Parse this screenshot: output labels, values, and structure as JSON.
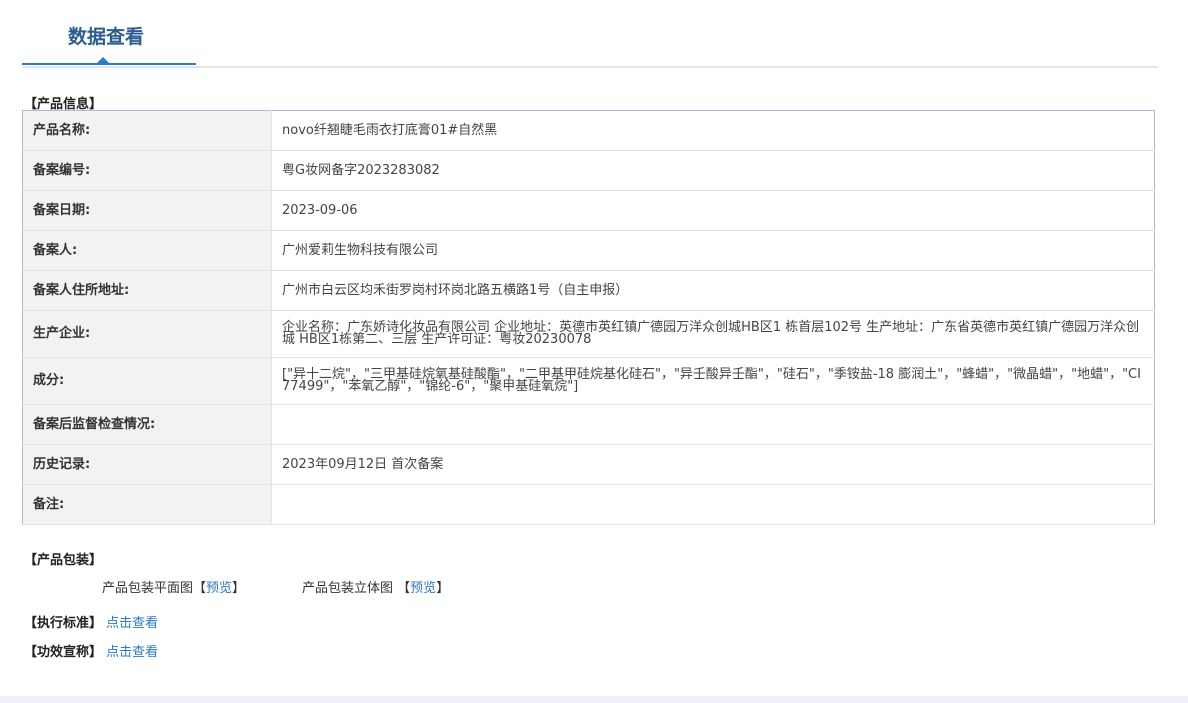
{
  "header": {
    "title": "数据查看"
  },
  "product_info": {
    "section_label": "【产品信息】",
    "rows": [
      {
        "label": "产品名称:",
        "value": "novo纤翘睫毛雨衣打底膏01#自然黑"
      },
      {
        "label": "备案编号:",
        "value": "粤G妆网备字2023283082"
      },
      {
        "label": "备案日期:",
        "value": "2023-09-06"
      },
      {
        "label": "备案人:",
        "value": "广州爱莉生物科技有限公司"
      },
      {
        "label": "备案人住所地址:",
        "value": "广州市白云区均禾街罗岗村环岗北路五横路1号（自主申报）"
      },
      {
        "label": "生产企业:",
        "value": "企业名称：广东娇诗化妆品有限公司 企业地址：英德市英红镇广德园万洋众创城HB区1 栋首层102号 生产地址：广东省英德市英红镇广德园万洋众创城 HB区1栋第二、三层 生产许可证：粤妆20230078"
      },
      {
        "label": "成分:",
        "value": "[\"异十二烷\"，\"三甲基硅烷氧基硅酸酯\"，\"二甲基甲硅烷基化硅石\"，\"异壬酸异壬酯\"，\"硅石\"，\"季铵盐-18 膨润土\"，\"蜂蜡\"，\"微晶蜡\"，\"地蜡\"，\"CI 77499\"，\"苯氧乙醇\"，\"锦纶-6\"，\"聚甲基硅氧烷\"]"
      },
      {
        "label": "备案后监督检查情况:",
        "value": ""
      },
      {
        "label": "历史记录:",
        "value": "2023年09月12日 首次备案"
      },
      {
        "label": "备注:",
        "value": ""
      }
    ]
  },
  "packaging": {
    "section_label": "【产品包装】",
    "flat": {
      "label": "产品包装平面图",
      "open": "【",
      "link": "预览",
      "close": "】"
    },
    "threed": {
      "label": "产品包装立体图",
      "open": "【",
      "link": "预览",
      "close": "】"
    }
  },
  "standard": {
    "label": "【执行标准】",
    "link": "点击查看"
  },
  "claims": {
    "label": "【功效宣称】",
    "link": "点击查看"
  }
}
